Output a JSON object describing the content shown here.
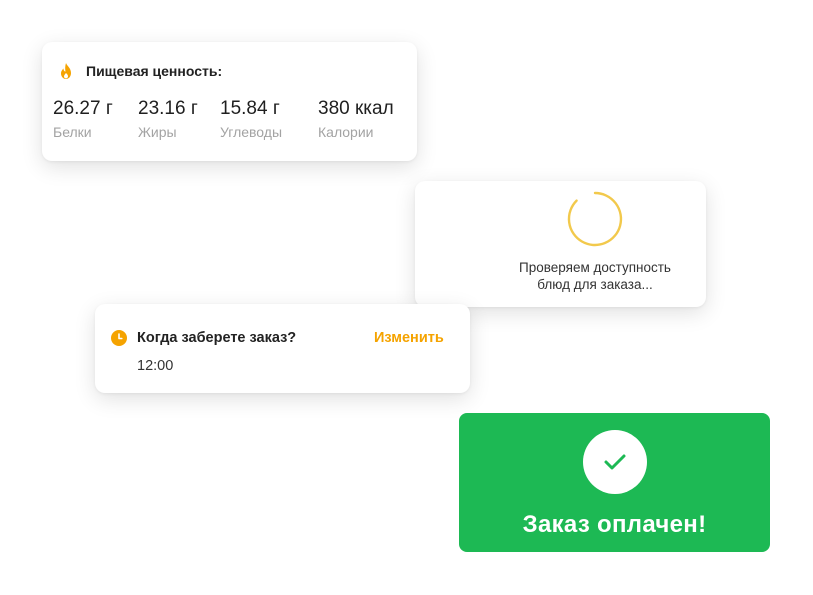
{
  "nutrition": {
    "title": "Пищевая ценность:",
    "items": [
      {
        "value": "26.27 г",
        "label": "Белки"
      },
      {
        "value": "23.16 г",
        "label": "Жиры"
      },
      {
        "value": "15.84 г",
        "label": "Углеводы"
      },
      {
        "value": "380 ккал",
        "label": "Калории"
      }
    ]
  },
  "loading": {
    "line1": "Проверяем доступность",
    "line2": "блюд для заказа..."
  },
  "pickup": {
    "question": "Когда заберете заказ?",
    "change_label": "Изменить",
    "time": "12:00"
  },
  "paid": {
    "message": "Заказ оплачен!"
  },
  "colors": {
    "accent": "#f5a300",
    "success": "#1db954",
    "spinner": "#f2c94c"
  }
}
